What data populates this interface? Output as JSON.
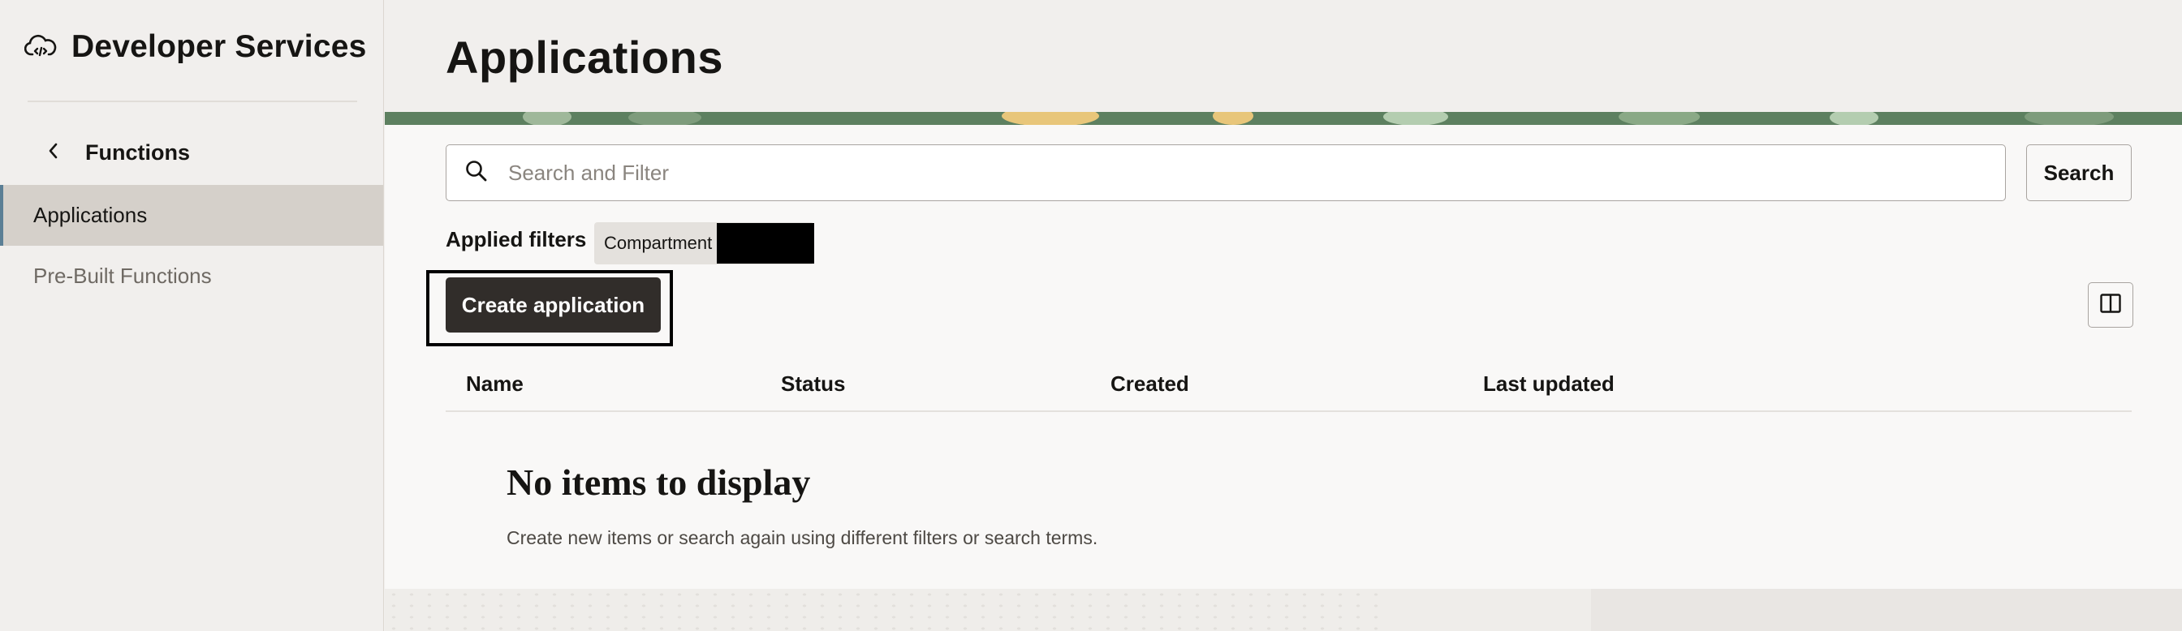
{
  "sidebar": {
    "brand": {
      "title": "Developer Services",
      "icon": "cloud-code-icon"
    },
    "back": {
      "label": "Functions",
      "icon": "chevron-left-icon"
    },
    "items": [
      {
        "label": "Applications",
        "active": true
      },
      {
        "label": "Pre-Built Functions",
        "active": false
      }
    ]
  },
  "main": {
    "title": "Applications",
    "search": {
      "placeholder": "Search and Filter",
      "value": "",
      "icon": "search-icon",
      "button_label": "Search"
    },
    "filters": {
      "label": "Applied filters",
      "chips": [
        {
          "label": "Compartment",
          "value_redacted": true
        }
      ]
    },
    "actions": {
      "create_label": "Create application",
      "columns_icon": "columns-icon"
    },
    "table": {
      "columns": [
        "Name",
        "Status",
        "Created",
        "Last updated"
      ],
      "rows": []
    },
    "empty_state": {
      "title": "No items to display",
      "subtitle": "Create new items or search again using different filters or search terms."
    }
  },
  "colors": {
    "accent_dark_button": "#312d2a",
    "sidebar_active": "#d5d0ca",
    "active_indicator": "#5b7f95",
    "banner_green": "#5d8060"
  }
}
